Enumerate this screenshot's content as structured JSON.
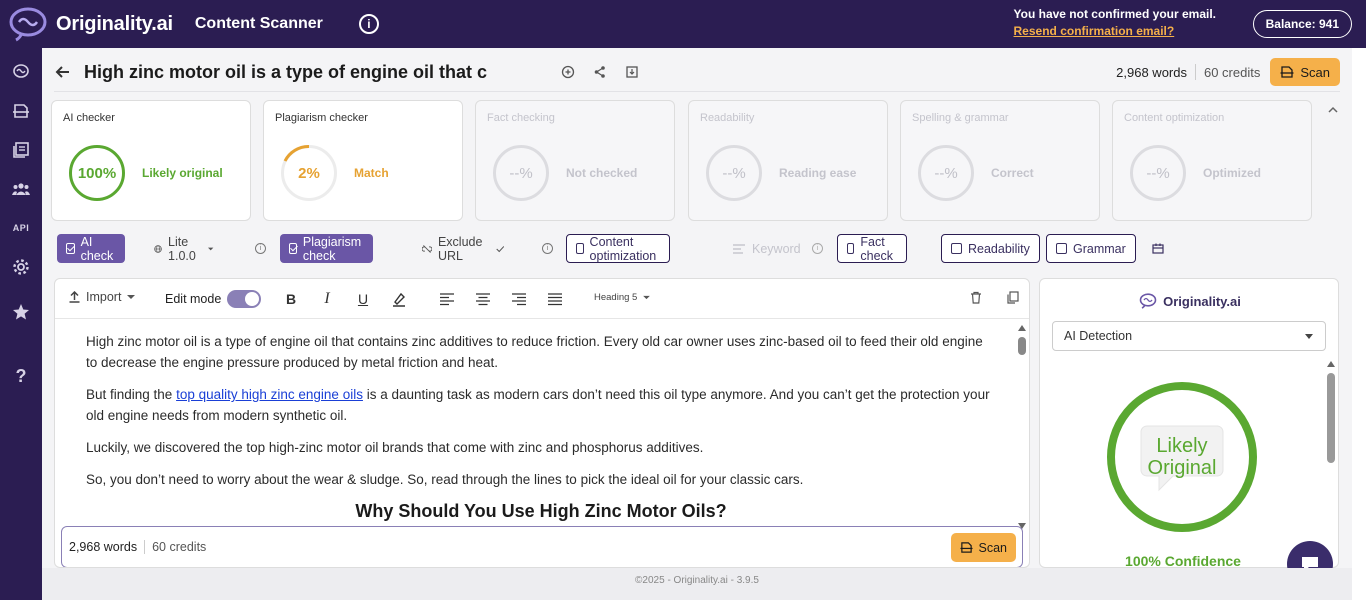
{
  "topbar": {
    "brand": "Originality.ai",
    "app_title": "Content Scanner",
    "email_notice": "You have not confirmed your email.",
    "resend_link": "Resend confirmation email?",
    "balance": "Balance: 941"
  },
  "sidebar": {
    "icons": [
      "brain-icon",
      "scan-icon",
      "library-icon",
      "team-icon",
      "api-icon",
      "settings-icon",
      "star-icon",
      "help-icon"
    ],
    "api_label": "API",
    "help_label": "?"
  },
  "document": {
    "title": "High zinc motor oil is a type of engine oil that c",
    "words": "2,968 words",
    "credits": "60 credits",
    "scan_label": "Scan"
  },
  "cards": [
    {
      "title": "AI checker",
      "value": "100%",
      "label": "Likely original",
      "state": "active"
    },
    {
      "title": "Plagiarism checker",
      "value": "2%",
      "label": "Match",
      "state": "active"
    },
    {
      "title": "Fact checking",
      "value": "--%",
      "label": "Not checked",
      "state": "disabled"
    },
    {
      "title": "Readability",
      "value": "--%",
      "label": "Reading ease",
      "state": "disabled"
    },
    {
      "title": "Spelling & grammar",
      "value": "--%",
      "label": "Correct",
      "state": "disabled"
    },
    {
      "title": "Content optimization",
      "value": "--%",
      "label": "Optimized",
      "state": "disabled"
    }
  ],
  "options": {
    "ai_check": "AI check",
    "model": "Lite 1.0.0",
    "plagiarism_check": "Plagiarism check",
    "exclude_url": "Exclude URL",
    "content_optimization": "Content optimization",
    "keyword": "Keyword",
    "fact_check": "Fact check",
    "readability": "Readability",
    "grammar": "Grammar"
  },
  "toolbar": {
    "import": "Import",
    "edit_mode": "Edit mode",
    "bold": "B",
    "italic": "I",
    "underline": "U",
    "heading": "Heading 5"
  },
  "content": {
    "p1": "High zinc motor oil is a type of engine oil that contains zinc additives to reduce friction. Every old car owner uses zinc-based oil to feed their old engine to decrease the engine pressure produced by metal friction and heat.",
    "p2_before": "But finding the ",
    "p2_link": "top quality high zinc engine oils",
    "p2_after": " is a daunting task as modern cars don’t need this oil type anymore. And you can’t get the protection your old engine needs from modern synthetic oil.",
    "p3": "Luckily, we discovered the top high-zinc motor oil brands that come with zinc and phosphorus additives.",
    "p4": "So, you don’t need to worry about the wear & sludge. So, read through the lines to pick the ideal oil for your classic cars.",
    "h2": "Why Should You Use High Zinc Motor Oils?"
  },
  "editor_footer": {
    "words": "2,968 words",
    "credits": "60 credits",
    "scan_label": "Scan"
  },
  "right_panel": {
    "brand": "Originality.ai",
    "select_value": "AI Detection",
    "ring_line1": "Likely",
    "ring_line2": "Original",
    "confidence": "100% Confidence"
  },
  "footer": {
    "text": "©2025 - Originality.ai - 3.9.5"
  },
  "colors": {
    "brand_dark": "#2b1d52",
    "accent_purple": "#6a56a6",
    "scan_orange": "#f5b04a",
    "success_green": "#5aa831"
  }
}
